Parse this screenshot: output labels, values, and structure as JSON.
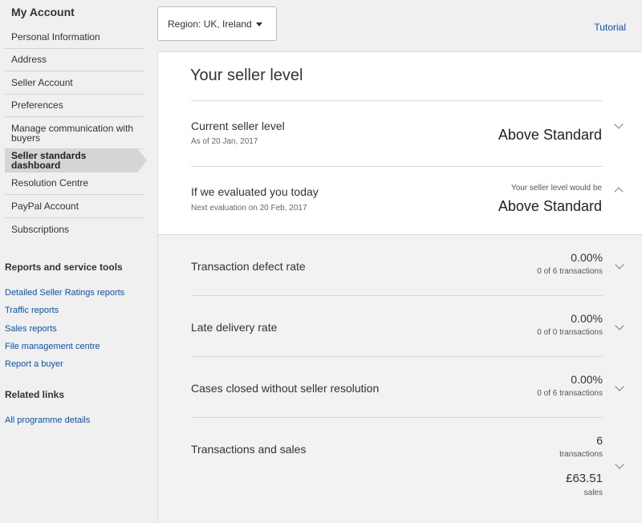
{
  "sidebar": {
    "title": "My Account",
    "items": [
      {
        "label": "Personal Information"
      },
      {
        "label": "Address"
      },
      {
        "label": "Seller Account"
      },
      {
        "label": "Preferences"
      },
      {
        "label": "Manage communication with buyers"
      },
      {
        "label": "Seller standards dashboard",
        "active": true
      },
      {
        "label": "Resolution Centre"
      },
      {
        "label": "PayPal Account"
      },
      {
        "label": "Subscriptions"
      }
    ],
    "reports_heading": "Reports and service tools",
    "reports_links": [
      {
        "label": "Detailed Seller Ratings reports"
      },
      {
        "label": "Traffic reports"
      },
      {
        "label": "Sales reports"
      },
      {
        "label": "File management centre"
      },
      {
        "label": "Report a buyer"
      }
    ],
    "related_heading": "Related links",
    "related_links": [
      {
        "label": "All programme details"
      }
    ]
  },
  "header": {
    "region_label": "Region: UK, Ireland",
    "tutorial_label": "Tutorial"
  },
  "seller_level": {
    "title": "Your seller level",
    "current": {
      "label": "Current seller level",
      "date": "As of 20 Jan, 2017",
      "value": "Above Standard"
    },
    "evaluated": {
      "label": "If we evaluated you today",
      "next": "Next evaluation on 20 Feb, 2017",
      "note": "Your seller level would be",
      "value": "Above Standard"
    }
  },
  "metrics": [
    {
      "label": "Transaction defect rate",
      "value": "0.00%",
      "sub": "0 of 6 transactions"
    },
    {
      "label": "Late delivery rate",
      "value": "0.00%",
      "sub": "0 of 0 transactions"
    },
    {
      "label": "Cases closed without seller resolution",
      "value": "0.00%",
      "sub": "0 of 6 transactions"
    }
  ],
  "transactions": {
    "label": "Transactions and sales",
    "count": "6",
    "count_unit": "transactions",
    "sales": "£63.51",
    "sales_unit": "sales"
  },
  "colors": {
    "link": "#0654ba",
    "active_nav": "#d5d5d5",
    "metrics_bg": "#f2f2f2"
  }
}
